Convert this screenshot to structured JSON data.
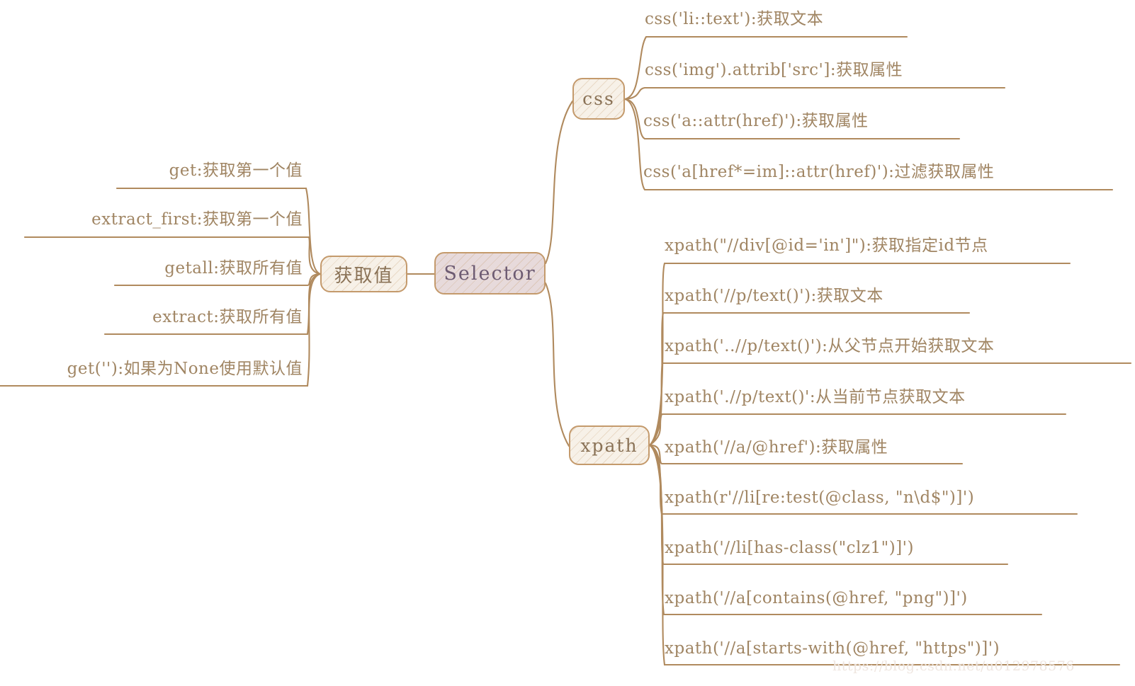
{
  "map": {
    "root": {
      "label": "Selector"
    },
    "left_branch": {
      "node": {
        "label": "获取值"
      },
      "items": [
        {
          "label": "get:获取第一个值"
        },
        {
          "label": "extract_first:获取第一个值"
        },
        {
          "label": "getall:获取所有值"
        },
        {
          "label": "extract:获取所有值"
        },
        {
          "label": "get(''):如果为None使用默认值"
        }
      ]
    },
    "right_branches": [
      {
        "node": {
          "label": "css"
        },
        "items": [
          {
            "label": "css('li::text'):获取文本"
          },
          {
            "label": "css('img').attrib['src']:获取属性"
          },
          {
            "label": "css('a::attr(href)'):获取属性"
          },
          {
            "label": "css('a[href*=im]::attr(href)'):过滤获取属性"
          }
        ]
      },
      {
        "node": {
          "label": "xpath"
        },
        "items": [
          {
            "label": "xpath(\"//div[@id='in']\"):获取指定id节点"
          },
          {
            "label": "xpath('//p/text()'):获取文本"
          },
          {
            "label": "xpath('..//p/text()'):从父节点开始获取文本"
          },
          {
            "label": "xpath('.//p/text()':从当前节点获取文本"
          },
          {
            "label": "xpath('//a/@href'):获取属性"
          },
          {
            "label": "xpath(r'//li[re:test(@class, \"n\\d$\")]')"
          },
          {
            "label": "xpath('//li[has-class(\"clz1\")]')"
          },
          {
            "label": "xpath('//a[contains(@href, \"png\")]')"
          },
          {
            "label": "xpath('//a[starts-with(@href, \"https\")]')"
          }
        ]
      }
    ]
  },
  "watermark": {
    "text": "https://blog.csdn.net/u012978576"
  },
  "colors": {
    "line": "#b08a5e",
    "node_border": "#c49a6c",
    "root_fill": "#e7dadb",
    "branch_fill": "#f7f1e8",
    "leaf_text": "#a08563",
    "root_text": "#6d5b72"
  }
}
